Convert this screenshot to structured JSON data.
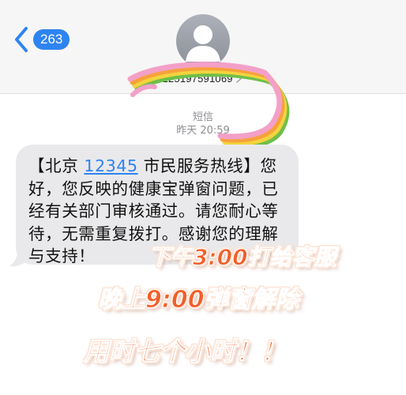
{
  "header": {
    "back_count": "263",
    "contact_number": "1069 125197591069"
  },
  "thread": {
    "label": "短信",
    "time": "昨天 20:59"
  },
  "message": {
    "prefix": "【北京 ",
    "hotline": "12345",
    "body": " 市民服务热线】您好，您反映的健康宝弹窗问题，已经有关部门审核通过。请您耐心等待，无需重复拨打。感谢您的理解与支持！"
  },
  "overlay": {
    "line1": "下午3:00打给客服",
    "line2": "晚上9:00弹窗解除",
    "line3": "用时七个小时！！"
  },
  "colors": {
    "accent": "#2e84f0",
    "bubble": "#e9e9eb",
    "overlay_text": "#f15f2a",
    "rainbow": [
      "#f3a0c8",
      "#f7a13c",
      "#f3d33d",
      "#6fbf4a"
    ]
  },
  "icons": [
    "chevron-left-icon",
    "person-icon",
    "chevron-right-icon"
  ]
}
